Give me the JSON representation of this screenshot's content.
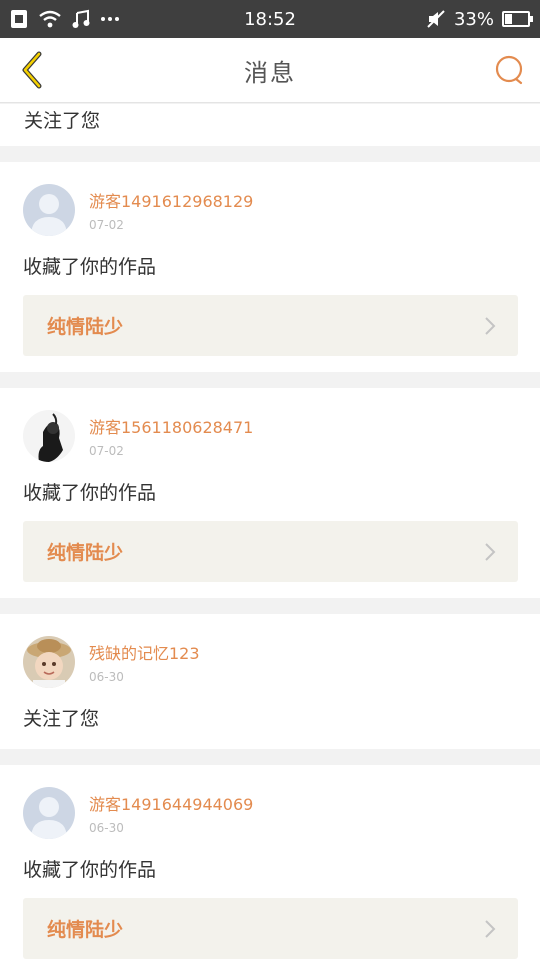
{
  "status_bar": {
    "time": "18:52",
    "battery_percent": "33%",
    "battery_level": 0.33,
    "icons": [
      "sim-card-icon",
      "wifi-icon",
      "music-note-icon",
      "more-dots-icon",
      "mute-icon",
      "battery-icon"
    ]
  },
  "header": {
    "title": "消息",
    "back_icon": "chevron-left-icon",
    "search_icon": "search-icon",
    "accent_color": "#e38b4f"
  },
  "partial_item": {
    "action": "关注了您"
  },
  "messages": [
    {
      "user": "游客1491612968129",
      "date": "07-02",
      "action": "收藏了你的作品",
      "work": "纯情陆少",
      "avatar": "default-avatar"
    },
    {
      "user": "游客1561180628471",
      "date": "07-02",
      "action": "收藏了你的作品",
      "work": "纯情陆少",
      "avatar": "photo-avatar"
    },
    {
      "user": "残缺的记忆123",
      "date": "06-30",
      "action": "关注了您",
      "avatar": "child-avatar"
    },
    {
      "user": "游客1491644944069",
      "date": "06-30",
      "action": "收藏了你的作品",
      "work": "纯情陆少",
      "avatar": "default-avatar"
    }
  ]
}
